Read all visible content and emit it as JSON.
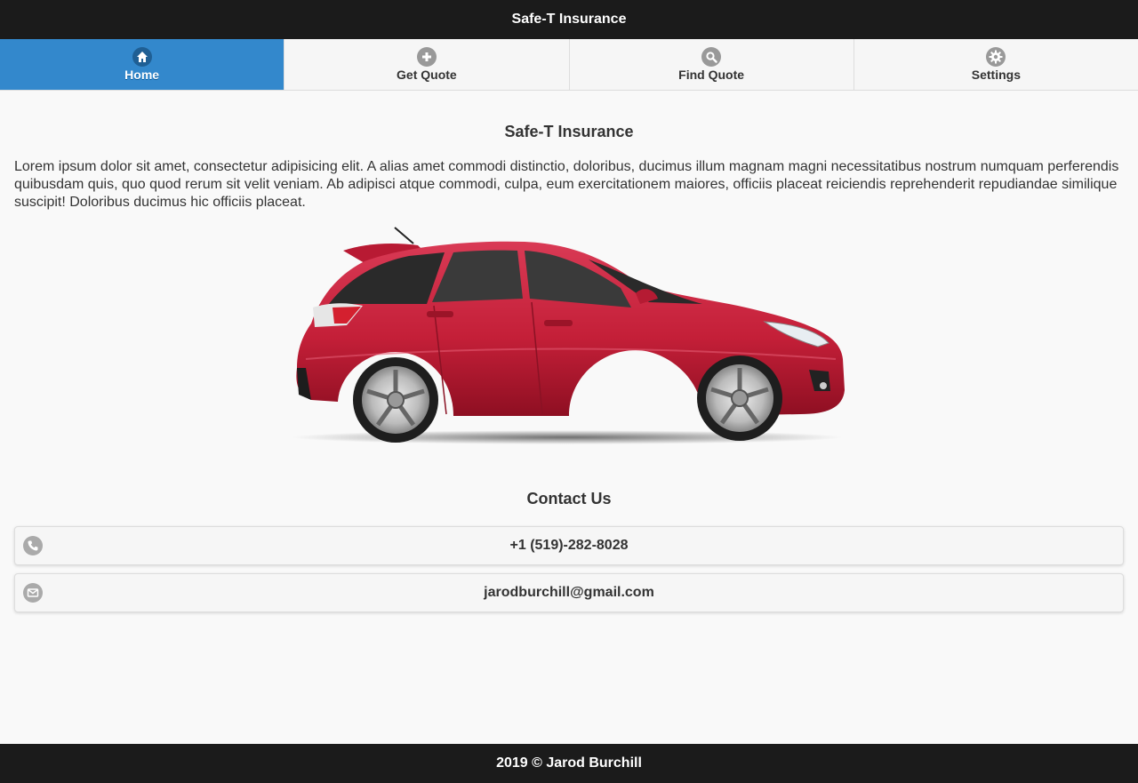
{
  "header": {
    "title": "Safe-T Insurance"
  },
  "nav": {
    "items": [
      {
        "label": "Home",
        "icon": "home-icon",
        "active": true
      },
      {
        "label": "Get Quote",
        "icon": "plus-icon",
        "active": false
      },
      {
        "label": "Find Quote",
        "icon": "search-icon",
        "active": false
      },
      {
        "label": "Settings",
        "icon": "gear-icon",
        "active": false
      }
    ]
  },
  "main": {
    "title": "Safe-T Insurance",
    "intro": "Lorem ipsum dolor sit amet, consectetur adipisicing elit. A alias amet commodi distinctio, doloribus, ducimus illum magnam magni necessitatibus nostrum numquam perferendis quibusdam quis, quo quod rerum sit velit veniam. Ab adipisci atque commodi, culpa, eum exercitationem maiores, officiis placeat reiciendis reprehenderit repudiandae similique suscipit! Doloribus ducimus hic officiis placeat."
  },
  "contact": {
    "title": "Contact Us",
    "phone": "+1 (519)-282-8028",
    "email": "jarodburchill@gmail.com"
  },
  "footer": {
    "text": "2019 © Jarod Burchill"
  },
  "colors": {
    "header_bg": "#1b1b1b",
    "active_tab": "#3388cc",
    "car_body": "#c8213b"
  }
}
